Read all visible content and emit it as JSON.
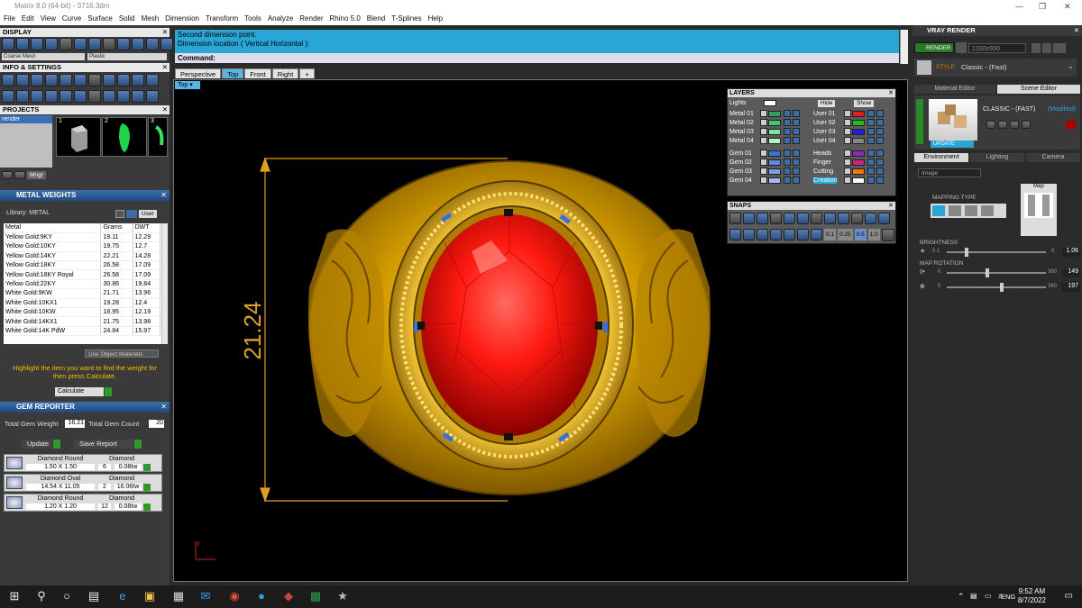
{
  "window": {
    "title": "Matrix 8.0 (64-bit) - 3716.3dm"
  },
  "menu": [
    "File",
    "Edit",
    "View",
    "Curve",
    "Surface",
    "Solid",
    "Mesh",
    "Dimension",
    "Transform",
    "Tools",
    "Analyze",
    "Render",
    "Rhino 5.0",
    "Blend",
    "T-Splines",
    "Help"
  ],
  "display": {
    "title": "DISPLAY",
    "mesh_select": "Coarse Mesh",
    "material_select": "Plastic"
  },
  "info": {
    "title": "INFO & SETTINGS"
  },
  "projects": {
    "title": "PROJECTS",
    "item": "render",
    "thumbs": [
      "1",
      "2",
      "3"
    ],
    "mngr": "Mngr"
  },
  "metal_weights": {
    "title": "METAL WEIGHTS",
    "library_label": "Library: METAL",
    "user_label": "User",
    "headers": [
      "Metal",
      "Grams",
      "DWT"
    ],
    "rows": [
      [
        "Yellow Gold:9KY",
        "19.11",
        "12.29"
      ],
      [
        "Yellow Gold:10KY",
        "19.75",
        "12.7"
      ],
      [
        "Yellow Gold:14KY",
        "22.21",
        "14.28"
      ],
      [
        "Yellow Gold:18KY",
        "26.58",
        "17.09"
      ],
      [
        "Yellow Gold:18KY Royal",
        "26.58",
        "17.09"
      ],
      [
        "Yellow Gold:22KY",
        "30.86",
        "19.84"
      ],
      [
        "White Gold:9KW",
        "21.71",
        "13.96"
      ],
      [
        "White Gold:10KX1",
        "19.28",
        "12.4"
      ],
      [
        "White Gold:10KW",
        "18.95",
        "12.19"
      ],
      [
        "White Gold:14KX1",
        "21.75",
        "13.98"
      ],
      [
        "White Gold:14K PdW",
        "24.84",
        "15.97"
      ]
    ],
    "use_object": "Use Object Materials",
    "hint": "Highlight the item you want to find the weight for then press Calculate.",
    "calculate": "Calculate"
  },
  "gem_reporter": {
    "title": "GEM REPORTER",
    "total_weight_label": "Total Gem Weight",
    "total_weight": "16.21",
    "total_count_label": "Total Gem Count",
    "total_count": "20",
    "update": "Update",
    "save": "Save Report",
    "gems": [
      {
        "shape": "Diamond Round",
        "size": "1.50 X 1.50",
        "material": "Diamond",
        "count": "6",
        "weight": "0.08tw"
      },
      {
        "shape": "Diamond Oval",
        "size": "14.54 X 11.05",
        "material": "Diamond",
        "count": "2",
        "weight": "16.06tw"
      },
      {
        "shape": "Diamond Round",
        "size": "1.20 X 1.20",
        "material": "Diamond",
        "count": "12",
        "weight": "0.08tw"
      }
    ]
  },
  "command": {
    "line1": "Second dimension point.",
    "line2": "Dimension location ( Vertical  Horizontal ):",
    "prompt": "Command:"
  },
  "viewport": {
    "tabs": [
      "Perspective",
      "Top",
      "Front",
      "Right"
    ],
    "active_tab": "Top",
    "label": "Top",
    "dimension": "21.24",
    "axis_y": "y"
  },
  "layers": {
    "title": "LAYERS",
    "lights": "Lights",
    "hide": "Hide",
    "show": "Show",
    "left": [
      {
        "name": "Metal 01",
        "color": "#2e9e58"
      },
      {
        "name": "Metal 02",
        "color": "#44c476"
      },
      {
        "name": "Metal 03",
        "color": "#7ee09c"
      },
      {
        "name": "Metal 04",
        "color": "#b4f0c4"
      },
      {
        "name": "Gem 01",
        "color": "#3d6fd8"
      },
      {
        "name": "Gem 02",
        "color": "#5b87e0"
      },
      {
        "name": "Gem 03",
        "color": "#7ea0e8"
      },
      {
        "name": "Gem 04",
        "color": "#a2baf0"
      }
    ],
    "right": [
      {
        "name": "User 01",
        "color": "#e02020"
      },
      {
        "name": "User 02",
        "color": "#20c020"
      },
      {
        "name": "User 03",
        "color": "#2020e0"
      },
      {
        "name": "User 04",
        "color": "#888888"
      },
      {
        "name": "Heads",
        "color": "#8a2ab8"
      },
      {
        "name": "Finger",
        "color": "#d02080"
      },
      {
        "name": "Cutting",
        "color": "#f07a10"
      },
      {
        "name": "Creation",
        "color": "#ffffff"
      }
    ]
  },
  "snaps": {
    "title": "SNAPS",
    "values": [
      "0.1",
      "0.25",
      "0.5",
      "1.0"
    ]
  },
  "vray": {
    "title": "VRAY RENDER",
    "render": "RENDER",
    "resolution": "1200x900",
    "style_label": "STYLE:",
    "style": "Classic - (Fast)",
    "tabs": [
      "Material Editor",
      "Scene Editor"
    ],
    "preset": "CLASSIC - (FAST)",
    "modified": "(Modified)",
    "update": "UPDATE",
    "env_tabs": [
      "Environment",
      "Lighting",
      "Camera"
    ],
    "image_select": "Image",
    "mapping_type": "MAPPING TYPE",
    "map_label": "Map",
    "brightness_label": "BRIGHTNESS",
    "brightness_min": "0.1",
    "brightness_max": "5",
    "brightness_value": "1.06",
    "map_rotation_label": "MAP ROTATION",
    "rot1_min": "0",
    "rot1_max": "360",
    "rot1_value": "149",
    "rot2_min": "0",
    "rot2_max": "360",
    "rot2_value": "197",
    "brightness_frac": 0.2,
    "rot1_frac": 0.41,
    "rot2_frac": 0.55
  },
  "taskbar": {
    "lang": "ENG",
    "time": "9:52 AM",
    "date": "8/7/2022"
  }
}
